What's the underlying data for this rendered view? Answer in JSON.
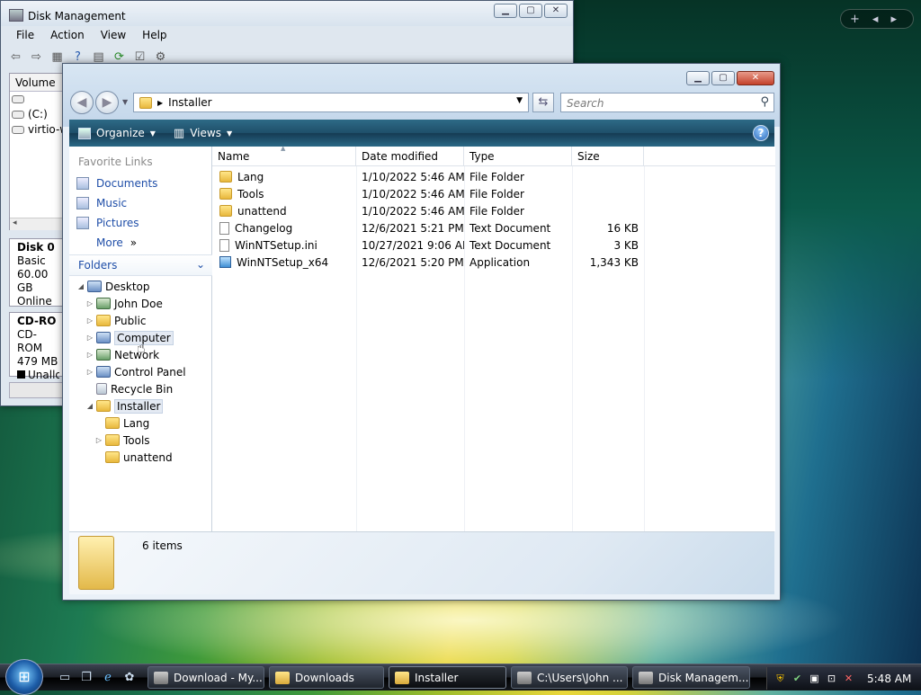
{
  "disk_mgmt": {
    "title": "Disk Management",
    "menu": [
      "File",
      "Action",
      "View",
      "Help"
    ],
    "volume_header": "Volume",
    "volumes": [
      "",
      "(C:)",
      "virtio-w"
    ],
    "disk0": {
      "name": "Disk 0",
      "type": "Basic",
      "size": "60.00 GB",
      "status": "Online"
    },
    "cdrom": {
      "name": "CD-RO",
      "type": "CD-ROM",
      "size": "479 MB",
      "legend": "Unalloca"
    }
  },
  "explorer": {
    "address": "Installer",
    "search_placeholder": "Search",
    "organize": "Organize",
    "views": "Views",
    "favorite_links_title": "Favorite Links",
    "favorite_links": [
      "Documents",
      "Music",
      "Pictures"
    ],
    "more": "More",
    "folders_title": "Folders",
    "tree": [
      {
        "label": "Desktop"
      },
      {
        "label": "John Doe"
      },
      {
        "label": "Public"
      },
      {
        "label": "Computer"
      },
      {
        "label": "Network"
      },
      {
        "label": "Control Panel"
      },
      {
        "label": "Recycle Bin"
      },
      {
        "label": "Installer"
      },
      {
        "label": "Lang"
      },
      {
        "label": "Tools"
      },
      {
        "label": "unattend"
      }
    ],
    "columns": [
      "Name",
      "Date modified",
      "Type",
      "Size"
    ],
    "files": [
      {
        "name": "Lang",
        "date": "1/10/2022 5:46 AM",
        "type": "File Folder",
        "size": ""
      },
      {
        "name": "Tools",
        "date": "1/10/2022 5:46 AM",
        "type": "File Folder",
        "size": ""
      },
      {
        "name": "unattend",
        "date": "1/10/2022 5:46 AM",
        "type": "File Folder",
        "size": ""
      },
      {
        "name": "Changelog",
        "date": "12/6/2021 5:21 PM",
        "type": "Text Document",
        "size": "16 KB"
      },
      {
        "name": "WinNTSetup.ini",
        "date": "10/27/2021 9:06 AM",
        "type": "Text Document",
        "size": "3 KB"
      },
      {
        "name": "WinNTSetup_x64",
        "date": "12/6/2021 5:20 PM",
        "type": "Application",
        "size": "1,343 KB"
      }
    ],
    "item_count": "6 items"
  },
  "taskbar": {
    "buttons": [
      "Download - My...",
      "Downloads",
      "Installer",
      "C:\\Users\\John ...",
      "Disk Managem..."
    ],
    "clock": "5:48 AM"
  }
}
